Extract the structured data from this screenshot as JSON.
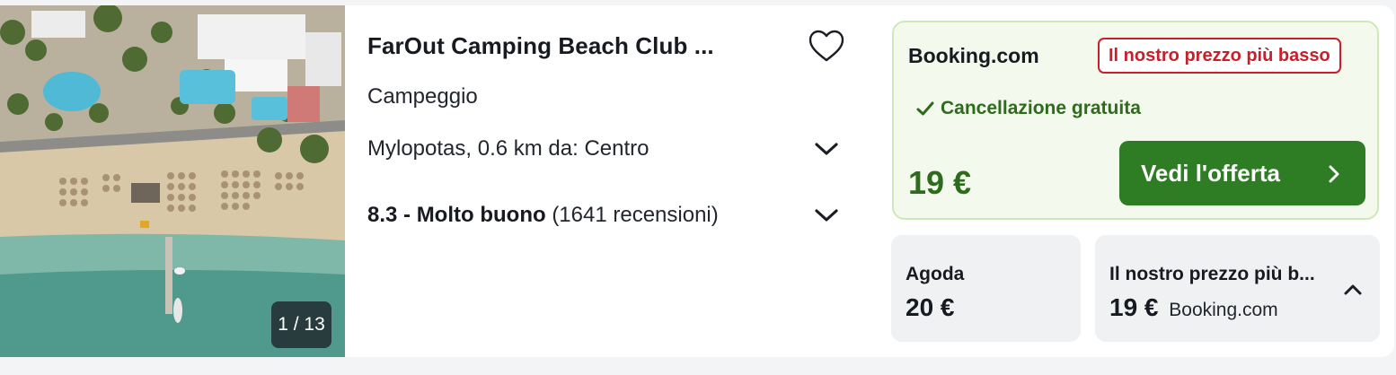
{
  "photo": {
    "counter": "1 / 13"
  },
  "hotel": {
    "title": "FarOut Camping Beach Club ...",
    "type": "Campeggio",
    "location": "Mylopotas, 0.6 km da: Centro",
    "rating_score": "8.3 - Molto buono",
    "rating_reviews": "(1641 recensioni)"
  },
  "deal": {
    "provider": "Booking.com",
    "badge": "Il nostro prezzo più basso",
    "cancellation": "Cancellazione gratuita",
    "price": "19 €",
    "cta_label": "Vedi l'offerta"
  },
  "alternatives": [
    {
      "provider": "Agoda",
      "price": "20 €",
      "sub": ""
    },
    {
      "provider": "Il nostro prezzo più b...",
      "price": "19 €",
      "sub": "Booking.com"
    }
  ],
  "colors": {
    "accent_green": "#2e7d24",
    "price_green": "#2f6b1c",
    "badge_red": "#c8202a",
    "deal_bg": "#f3f9ec"
  },
  "icons": {
    "favorite": "heart-icon",
    "expand": "chevron-down-icon",
    "collapse": "chevron-up-icon",
    "check": "check-icon",
    "cta_arrow": "chevron-right-icon"
  }
}
